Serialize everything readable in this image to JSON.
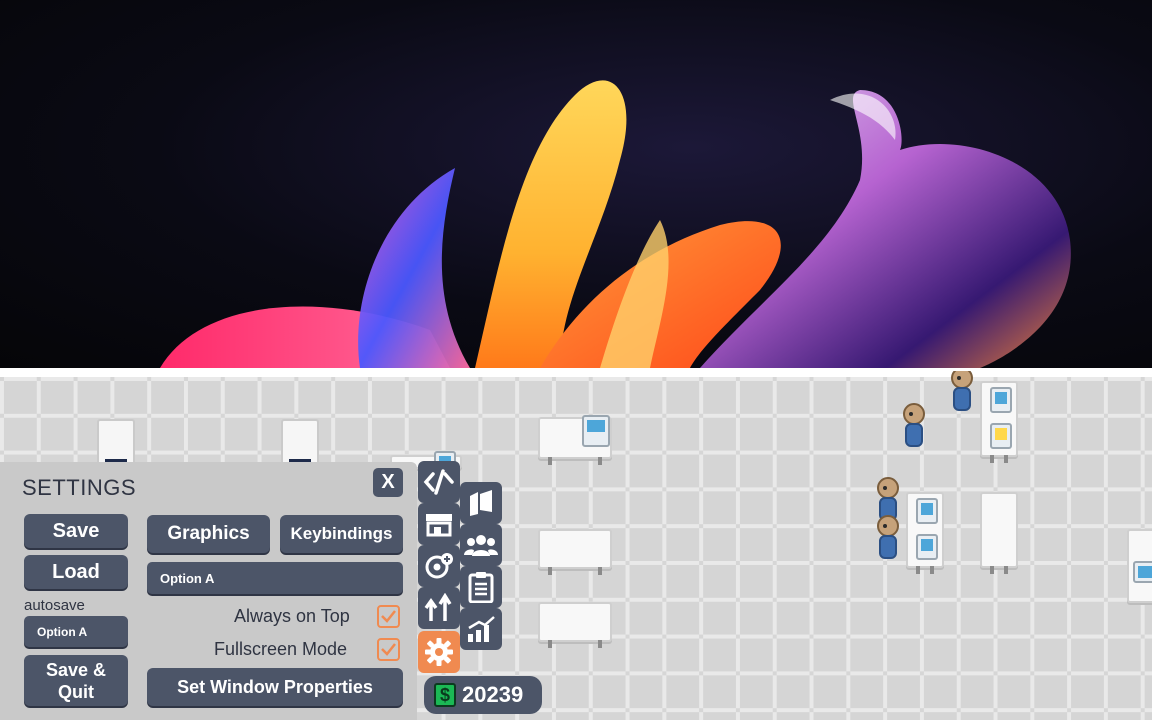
{
  "settings": {
    "title": "SETTINGS",
    "close_label": "X",
    "save_label": "Save",
    "load_label": "Load",
    "autosave_label": "autosave",
    "autosave_option": "Option A",
    "save_quit_label": "Save & Quit",
    "graphics_tab": "Graphics",
    "keybindings_tab": "Keybindings",
    "graphics_option": "Option A",
    "always_on_top_label": "Always on Top",
    "always_on_top_checked": true,
    "fullscreen_label": "Fullscreen Mode",
    "fullscreen_checked": true,
    "set_window_label": "Set Window Properties"
  },
  "toolbar": {
    "tools": [
      {
        "name": "code-icon",
        "active": false
      },
      {
        "name": "storefront-icon",
        "active": false
      },
      {
        "name": "add-gear-icon",
        "active": false
      },
      {
        "name": "upgrade-arrows-icon",
        "active": false
      },
      {
        "name": "gear-icon",
        "active": true
      },
      {
        "name": "map-icon",
        "active": false
      },
      {
        "name": "team-icon",
        "active": false
      },
      {
        "name": "clipboard-icon",
        "active": false
      },
      {
        "name": "stats-icon",
        "active": false
      }
    ]
  },
  "money": {
    "symbol": "$",
    "amount": "20239"
  },
  "colors": {
    "panel_bg": "#c9c9c9",
    "button": "#4c5568",
    "accent": "#f08a50",
    "money_green": "#1bb955"
  }
}
